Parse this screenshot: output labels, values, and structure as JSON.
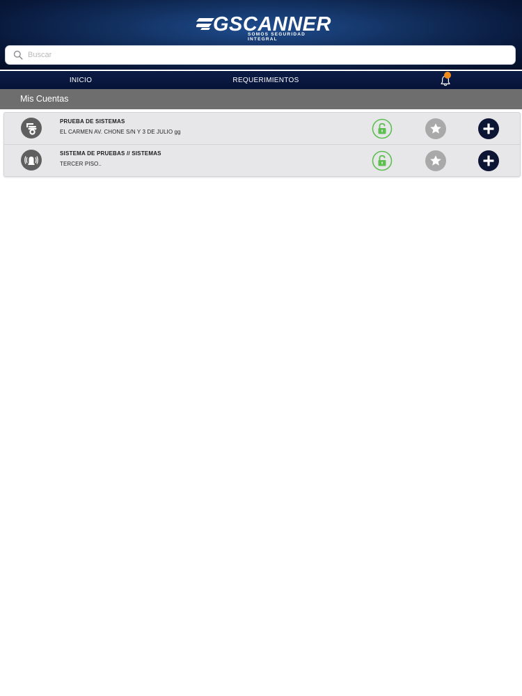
{
  "app": {
    "logo_text": "GSCANNER",
    "logo_tagline": "SOMOS SEGURIDAD INTEGRAL"
  },
  "search": {
    "placeholder": "Buscar",
    "value": ""
  },
  "tabs": {
    "inicio": "INICIO",
    "requerimientos": "REQUERIMIENTOS"
  },
  "section": {
    "title": "Mis Cuentas"
  },
  "accounts": [
    {
      "title": "PRUEBA DE  SISTEMAS",
      "address": "EL CARMEN AV. CHONE S/N Y 3 DE JULIO gg",
      "icon": "cctv-camera-icon"
    },
    {
      "title": "SISTEMA DE PRUEBAS // SISTEMAS",
      "address": "TERCER PISO..",
      "icon": "alarm-siren-icon"
    }
  ],
  "colors": {
    "header_dark": "#08183a",
    "header_light": "#1f4d8f",
    "tabbar": "#0a1840",
    "section_header": "#6e6e6e",
    "lock_green": "#5cbf4f",
    "star_gray": "#a9a9a9",
    "add_navy": "#0d1535",
    "badge_orange": "#ef8a1c"
  }
}
